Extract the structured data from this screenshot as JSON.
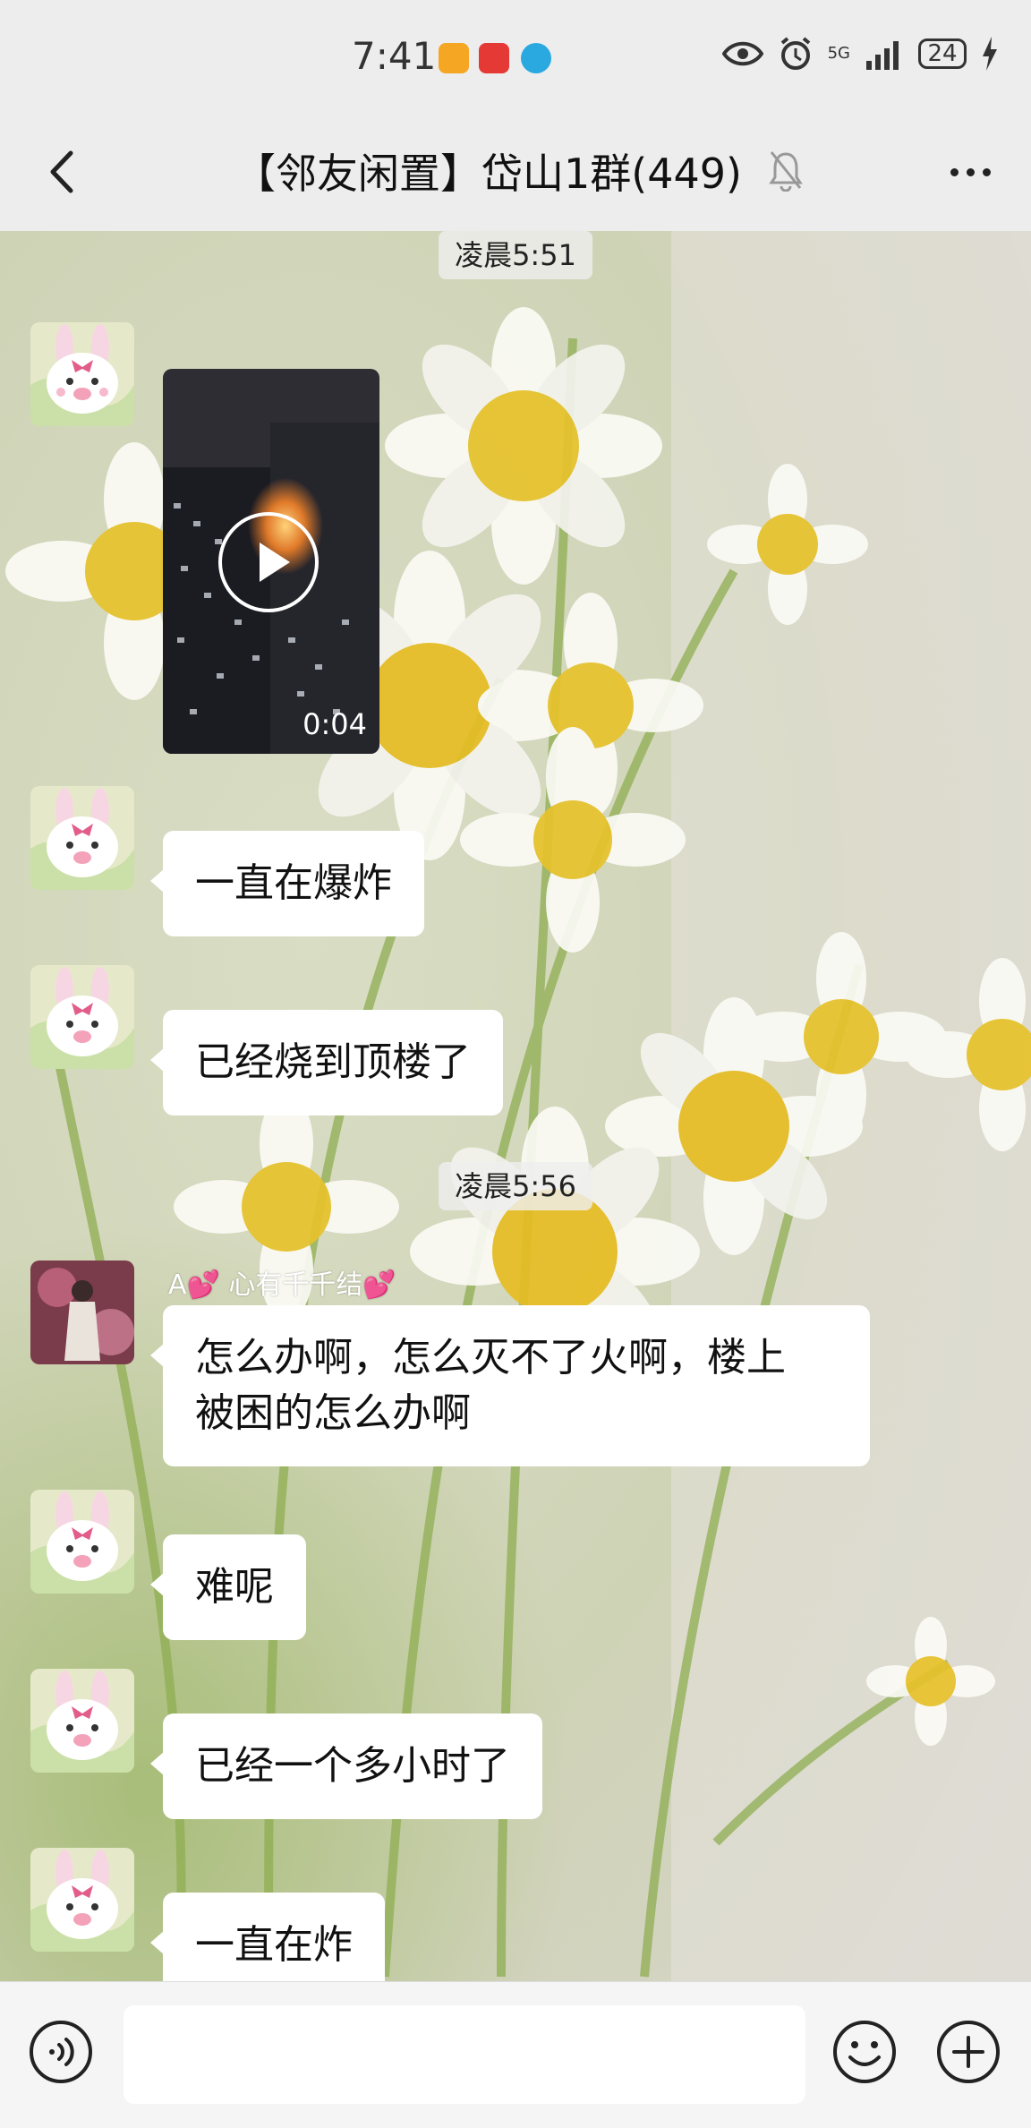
{
  "status_bar": {
    "time": "7:41",
    "network": "5G",
    "battery": "24"
  },
  "header": {
    "title": "【邻友闲置】岱山1群(449)"
  },
  "chat": {
    "timestamp_1": "凌晨5:51",
    "video_duration": "0:04",
    "msg_1": "一直在爆炸",
    "msg_2": "已经烧到顶楼了",
    "timestamp_2": "凌晨5:56",
    "nick_a": "A💕 心有千千结💕",
    "msg_3_line1": "怎么办啊，怎么灭不了火啊，楼上",
    "msg_3_line2": "被困的怎么办啊",
    "msg_4": "难呢",
    "msg_5": "已经一个多小时了",
    "msg_6": "一直在炸"
  },
  "input_bar": {
    "placeholder": ""
  },
  "colors": {
    "background": "#ededed",
    "bubble": "#ffffff",
    "daisy_center": "#e8c22b"
  }
}
